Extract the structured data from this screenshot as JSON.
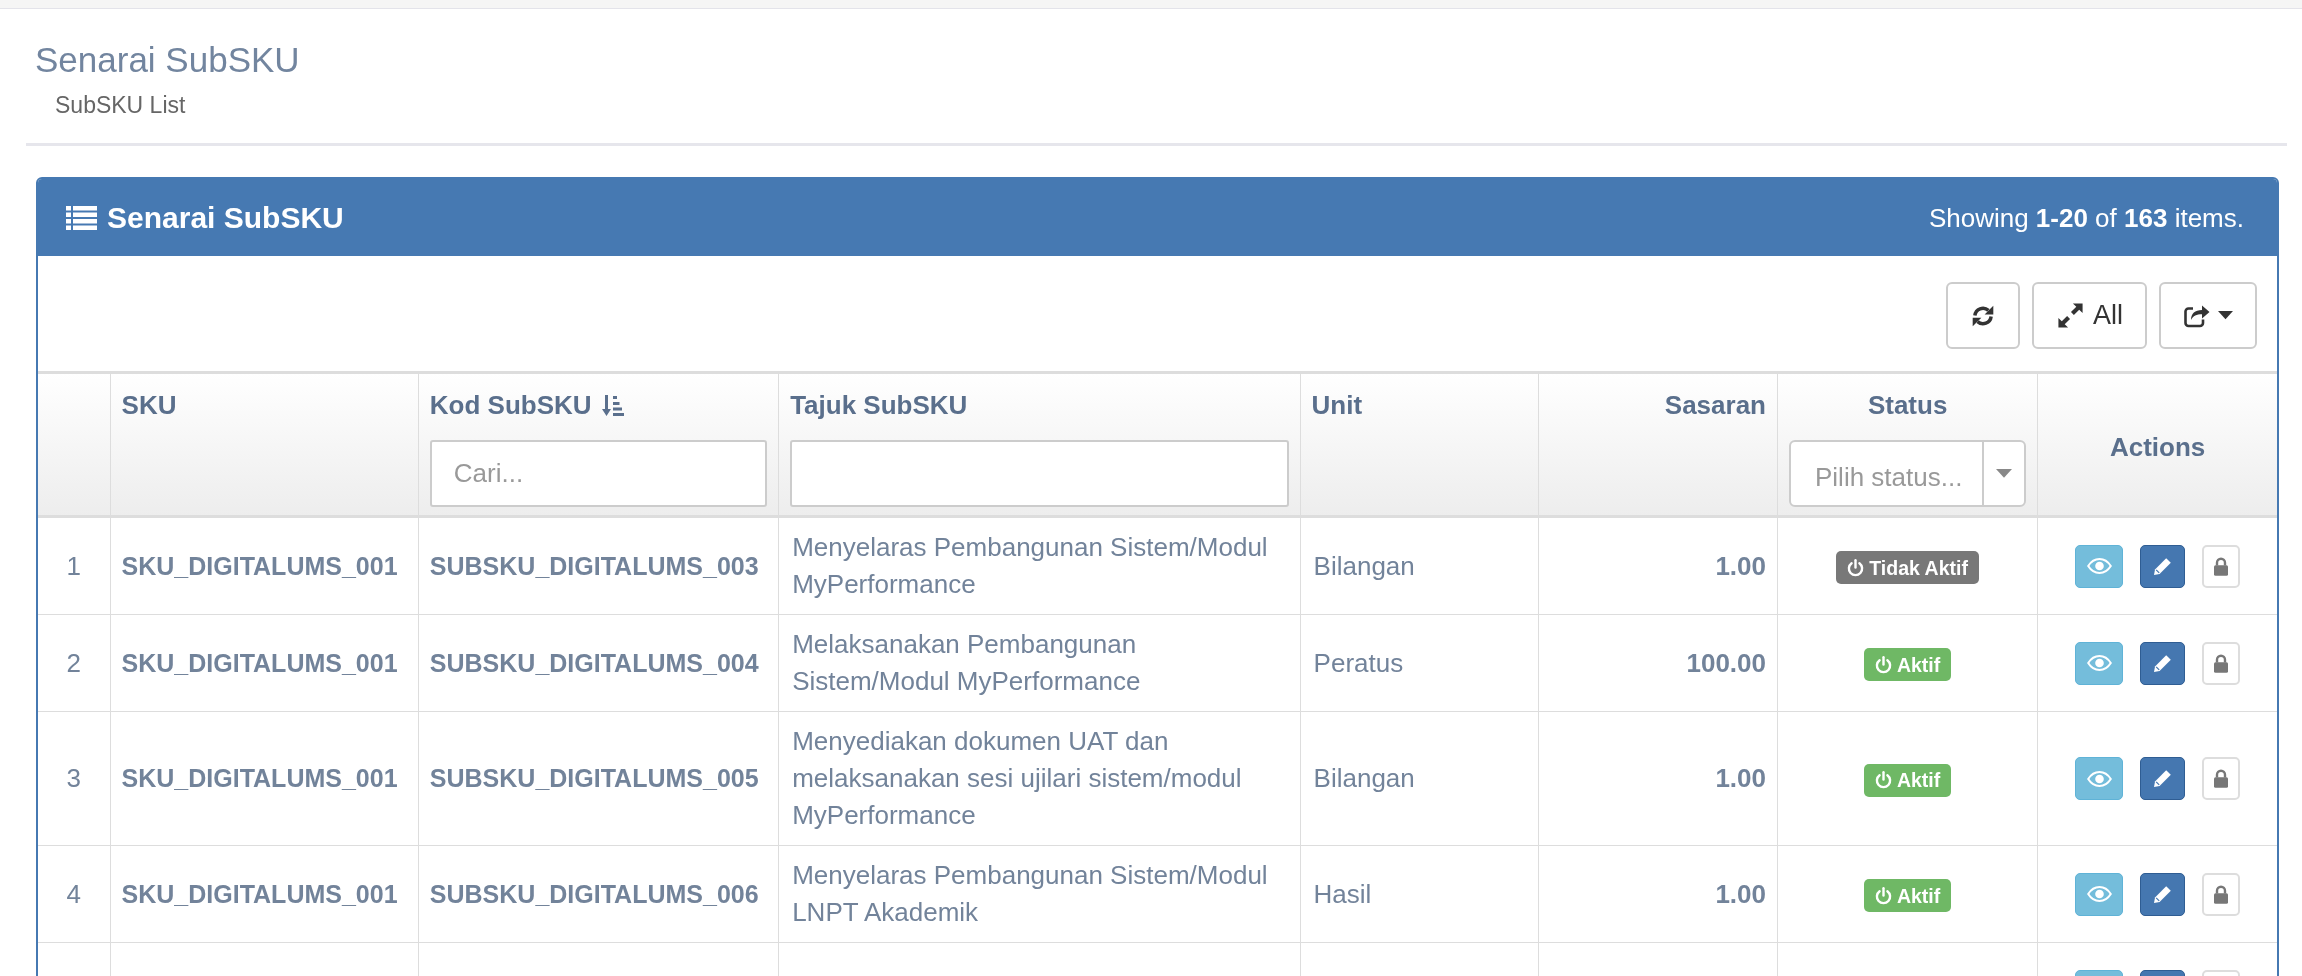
{
  "page_header": {
    "title": "Senarai SubSKU",
    "subtitle": "SubSKU List"
  },
  "panel": {
    "title": "Senarai SubSKU",
    "summary": "Showing **1-20** of **163** items."
  },
  "toolbar": [
    {
      "kind": "refresh"
    },
    {
      "kind": "expand",
      "label": "All"
    },
    {
      "kind": "export"
    }
  ],
  "table": {
    "columns": [
      {
        "kind": "index"
      },
      {
        "kind": "code",
        "label": "SKU",
        "sorted": false
      },
      {
        "kind": "code",
        "label": "Kod SubSKU",
        "sorted": true,
        "filter": {
          "kind": "text",
          "placeholder": "Cari..."
        }
      },
      {
        "kind": "long_text",
        "label": "Tajuk SubSKU",
        "sorted": false,
        "filter": {
          "kind": "text"
        }
      },
      {
        "kind": "text",
        "label": "Unit",
        "sorted": false
      },
      {
        "kind": "number",
        "label": "Sasaran",
        "sorted": false
      },
      {
        "kind": "status",
        "label": "Status",
        "sorted": false,
        "filter": {
          "kind": "select",
          "placeholder": "Pilih status..."
        }
      },
      {
        "kind": "actions",
        "label": "Actions",
        "sorted": false
      }
    ],
    "rows": [
      {
        "number": "1",
        "sku": "SKU_DIGITALUMS_001",
        "code": "SUBSKU_DIGITALUMS_003",
        "title": "Menyelaras Pembangunan Sistem/Modul MyPerformance",
        "unit": "Bilangan",
        "target": "1.00",
        "status": {
          "label": "Tidak Aktif",
          "active": false
        },
        "actions": [
          {
            "kind": "view"
          },
          {
            "kind": "edit"
          },
          {
            "kind": "lock"
          }
        ]
      },
      {
        "number": "2",
        "sku": "SKU_DIGITALUMS_001",
        "code": "SUBSKU_DIGITALUMS_004",
        "title": "Melaksanakan Pembangunan Sistem/Modul MyPerformance",
        "unit": "Peratus",
        "target": "100.00",
        "status": {
          "label": "Aktif",
          "active": true
        },
        "actions": [
          {
            "kind": "view"
          },
          {
            "kind": "edit"
          },
          {
            "kind": "lock"
          }
        ]
      },
      {
        "number": "3",
        "sku": "SKU_DIGITALUMS_001",
        "code": "SUBSKU_DIGITALUMS_005",
        "title": "Menyediakan dokumen UAT dan melaksanakan sesi ujilari sistem/modul MyPerformance",
        "unit": "Bilangan",
        "target": "1.00",
        "status": {
          "label": "Aktif",
          "active": true
        },
        "actions": [
          {
            "kind": "view"
          },
          {
            "kind": "edit"
          },
          {
            "kind": "lock"
          }
        ]
      },
      {
        "number": "4",
        "sku": "SKU_DIGITALUMS_001",
        "code": "SUBSKU_DIGITALUMS_006",
        "title": "Menyelaras Pembangunan Sistem/Modul LNPT Akademik",
        "unit": "Hasil",
        "target": "1.00",
        "status": {
          "label": "Aktif",
          "active": true
        },
        "actions": [
          {
            "kind": "view"
          },
          {
            "kind": "edit"
          },
          {
            "kind": "lock"
          }
        ]
      },
      {
        "actions": [
          {
            "kind": "view"
          },
          {
            "kind": "edit"
          },
          {
            "kind": "lock"
          }
        ]
      }
    ]
  }
}
